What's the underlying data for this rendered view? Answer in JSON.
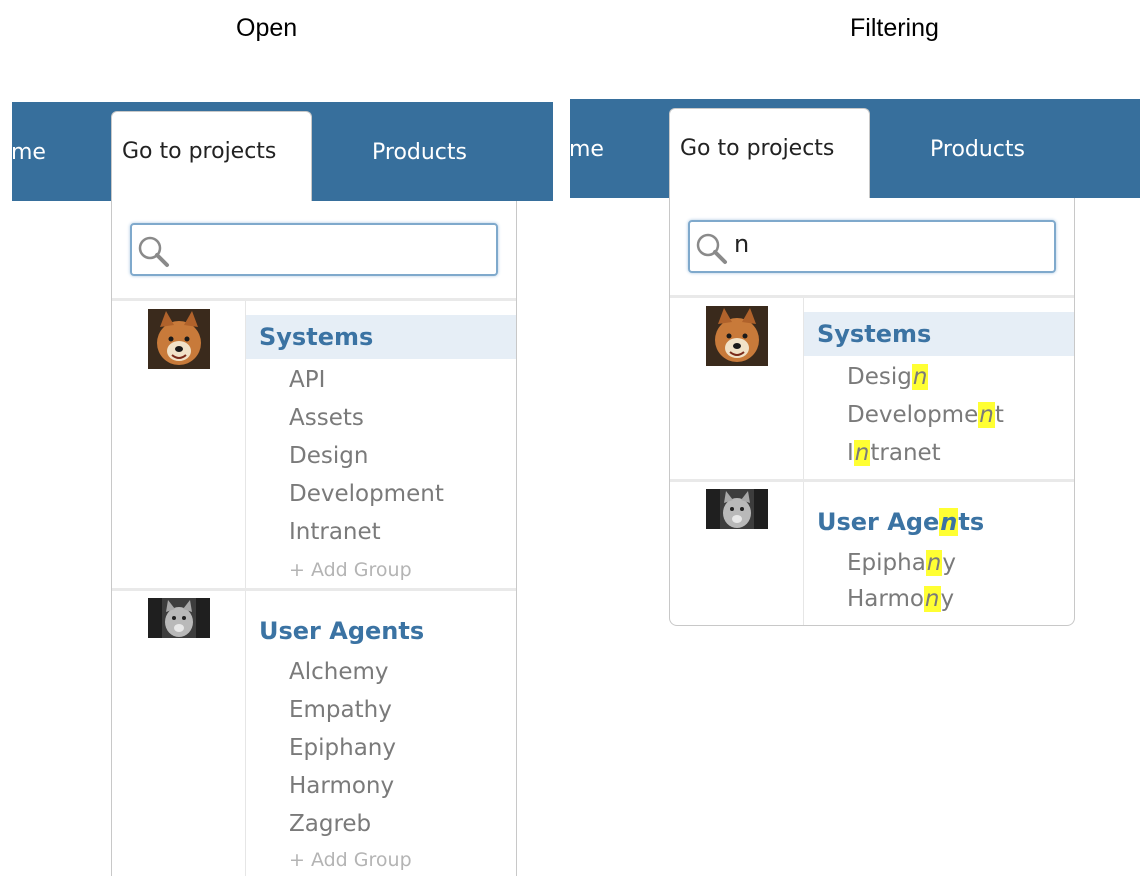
{
  "captions": {
    "left": "Open",
    "right": "Filtering"
  },
  "colors": {
    "nav": "#376f9c",
    "group_title": "#3b73a3",
    "highlight": "#ffff33"
  },
  "open": {
    "nav": {
      "partial": "me",
      "active_tab": "Go to projects",
      "products": "Products"
    },
    "search": {
      "value": "",
      "icon": "search-icon"
    },
    "groups": [
      {
        "title": "Systems",
        "avatar": "shiba-dog-avatar",
        "items": [
          "API",
          "Assets",
          "Design",
          "Development",
          "Intranet"
        ],
        "add_label": "+ Add Group"
      },
      {
        "title": "User Agents",
        "avatar": "gray-cat-avatar",
        "items": [
          "Alchemy",
          "Empathy",
          "Epiphany",
          "Harmony",
          "Zagreb"
        ],
        "add_label": "+ Add Group"
      }
    ]
  },
  "filtering": {
    "nav": {
      "partial": "me",
      "active_tab": "Go to projects",
      "products": "Products"
    },
    "search": {
      "value": "n",
      "icon": "search-icon"
    },
    "groups": [
      {
        "title": "Systems",
        "avatar": "shiba-dog-avatar",
        "items": [
          {
            "before": "Desig",
            "match": "n",
            "after": ""
          },
          {
            "before": "Developme",
            "match": "n",
            "after": "t"
          },
          {
            "before": "I",
            "match": "n",
            "after": "tranet"
          }
        ]
      },
      {
        "title": {
          "before": "User Age",
          "match": "n",
          "after": "ts"
        },
        "avatar": "gray-cat-avatar",
        "items": [
          {
            "before": "Epipha",
            "match": "n",
            "after": "y"
          },
          {
            "before": "Harmo",
            "match": "n",
            "after": "y"
          }
        ]
      }
    ]
  }
}
